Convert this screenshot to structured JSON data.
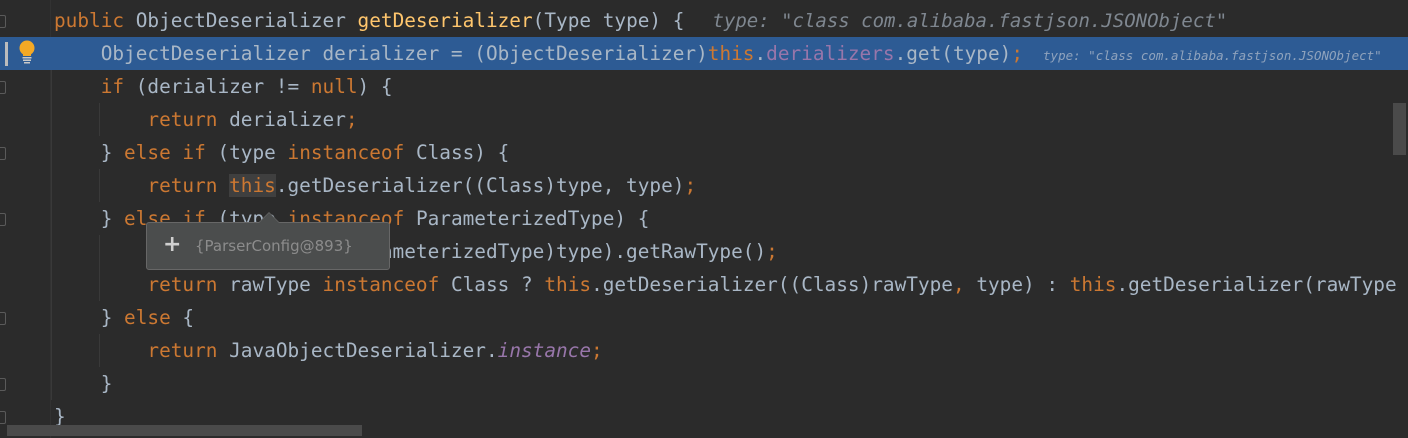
{
  "editor": {
    "language": "java",
    "current_line": 1,
    "lines": [
      {
        "tokens": [
          [
            "public ",
            "kw"
          ],
          [
            "ObjectDeserializer ",
            "t"
          ],
          [
            "getDeserializer",
            "fn"
          ],
          [
            "(Type type) {",
            "t"
          ]
        ],
        "hint": "type: \"class com.alibaba.fastjson.JSONObject\""
      },
      {
        "tokens": [
          [
            "    ObjectDeserializer derializer = (ObjectDeserializer)",
            "t"
          ],
          [
            "this",
            "kw"
          ],
          [
            ".",
            "t"
          ],
          [
            "derializers",
            "field"
          ],
          [
            ".get(type)",
            "t"
          ],
          [
            ";",
            "kw"
          ]
        ],
        "hint": "type: \"class com.alibaba.fastjson.JSONObject\""
      },
      {
        "tokens": [
          [
            "    if",
            "kw"
          ],
          [
            " (derializer != ",
            "t"
          ],
          [
            "null",
            "kw"
          ],
          [
            ") {",
            "t"
          ]
        ]
      },
      {
        "tokens": [
          [
            "        return",
            "kw"
          ],
          [
            " derializer",
            "t"
          ],
          [
            ";",
            "kw"
          ]
        ]
      },
      {
        "tokens": [
          [
            "    } ",
            "t"
          ],
          [
            "else if",
            "kw"
          ],
          [
            " (type ",
            "t"
          ],
          [
            "instanceof",
            "kw"
          ],
          [
            " Class) {",
            "t"
          ]
        ]
      },
      {
        "tokens": [
          [
            "        return ",
            "kw"
          ],
          [
            "this",
            "kw hl"
          ],
          [
            ".getDeserializer((Class)type, type)",
            "t"
          ],
          [
            ";",
            "kw"
          ]
        ]
      },
      {
        "tokens": [
          [
            "    } ",
            "t"
          ],
          [
            "else if",
            "kw"
          ],
          [
            " (type ",
            "t"
          ],
          [
            "instanceof",
            "kw"
          ],
          [
            " ParameterizedType) {",
            "t"
          ]
        ]
      },
      {
        "tokens": [
          [
            "        Type rawType = ((ParameterizedType)type).getRawType()",
            "t"
          ],
          [
            ";",
            "kw"
          ]
        ]
      },
      {
        "tokens": [
          [
            "        return",
            "kw"
          ],
          [
            " rawType ",
            "t"
          ],
          [
            "instanceof",
            "kw"
          ],
          [
            " Class ? ",
            "t"
          ],
          [
            "this",
            "kw"
          ],
          [
            ".getDeserializer((Class)rawType",
            "t"
          ],
          [
            ",",
            "kw"
          ],
          [
            " type) : ",
            "t"
          ],
          [
            "this",
            "kw"
          ],
          [
            ".getDeserializer(rawType",
            "t"
          ]
        ]
      },
      {
        "tokens": [
          [
            "    } ",
            "t"
          ],
          [
            "else",
            "kw"
          ],
          [
            " {",
            "t"
          ]
        ]
      },
      {
        "tokens": [
          [
            "        return",
            "kw"
          ],
          [
            " JavaObjectDeserializer.",
            "t"
          ],
          [
            "instance",
            "fieldi"
          ],
          [
            ";",
            "kw"
          ]
        ]
      },
      {
        "tokens": [
          [
            "    }",
            "t"
          ]
        ]
      },
      {
        "tokens": [
          [
            "}",
            "t"
          ]
        ]
      }
    ],
    "fold_marker_lines": [
      0,
      2,
      4,
      6,
      9,
      11,
      12
    ]
  },
  "tooltip": {
    "expand_icon": "plus-icon",
    "value": "{ParserConfig@893}"
  },
  "gutter": {
    "intention_icon": "lightbulb-icon"
  },
  "colors": {
    "background": "#2b2b2b",
    "current_line": "#2d5b94",
    "keyword": "#cc7832",
    "method": "#ffc66d",
    "field": "#9876aa",
    "text": "#a9b7c6",
    "bulb": "#f4a925"
  }
}
